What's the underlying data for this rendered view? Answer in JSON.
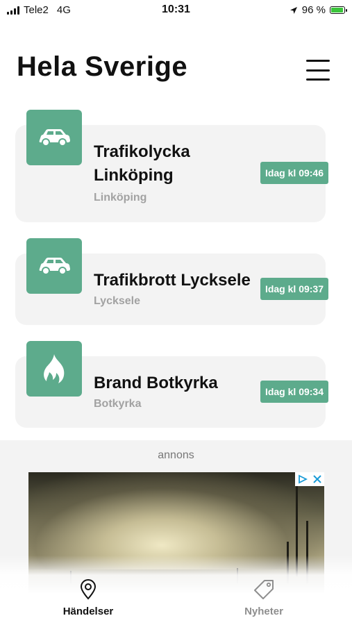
{
  "status_bar": {
    "carrier": "Tele2",
    "network": "4G",
    "time": "10:31",
    "battery_percent": "96 %",
    "battery_level": 0.96
  },
  "header": {
    "title": "Hela Sverige",
    "menu_icon": "hamburger-menu-icon"
  },
  "events": [
    {
      "icon": "car-icon",
      "title_lines": [
        "Trafikolycka",
        "Linköping"
      ],
      "location": "Linköping",
      "time": "Idag kl 09:46"
    },
    {
      "icon": "car-icon",
      "title_lines": [
        "Trafikbrott Lycksele"
      ],
      "location": "Lycksele",
      "time": "Idag kl 09:37"
    },
    {
      "icon": "fire-icon",
      "title_lines": [
        "Brand Botkyrka"
      ],
      "location": "Botkyrka",
      "time": "Idag kl 09:34"
    }
  ],
  "ad": {
    "label": "annons",
    "badge_icons": [
      "adchoices-icon",
      "close-icon"
    ]
  },
  "tabs": [
    {
      "label": "Händelser",
      "icon": "map-pin-icon",
      "active": true
    },
    {
      "label": "Nyheter",
      "icon": "tag-icon",
      "active": false
    }
  ],
  "colors": {
    "accent": "#5dab8c",
    "card_background": "#f3f3f3",
    "secondary_text": "#a2a2a2",
    "active_tab": "#111111",
    "inactive_tab": "#8e8e8e"
  }
}
